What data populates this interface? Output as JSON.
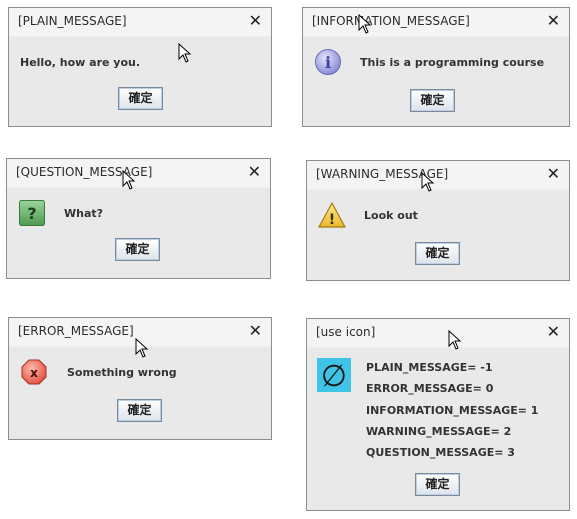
{
  "dialogs": [
    {
      "title": "[PLAIN_MESSAGE]",
      "message": "Hello, how are you.",
      "ok_label": "確定",
      "icon": "none"
    },
    {
      "title": "[INFORMATION_MESSAGE]",
      "message": "This is a programming course",
      "ok_label": "確定",
      "icon": "info-icon"
    },
    {
      "title": "[QUESTION_MESSAGE]",
      "message": "What?",
      "ok_label": "確定",
      "icon": "question-icon"
    },
    {
      "title": "[WARNING_MESSAGE]",
      "message": "Look out",
      "ok_label": "確定",
      "icon": "warning-icon"
    },
    {
      "title": "[ERROR_MESSAGE]",
      "message": "Something wrong",
      "ok_label": "確定",
      "icon": "error-icon"
    },
    {
      "title": "[use icon]",
      "messages": [
        "PLAIN_MESSAGE= -1",
        "ERROR_MESSAGE= 0",
        "INFORMATION_MESSAGE= 1",
        "WARNING_MESSAGE= 2",
        "QUESTION_MESSAGE= 3"
      ],
      "ok_label": "確定",
      "icon": "empty-set-icon"
    }
  ],
  "close_glyph": "✕",
  "icon_glyphs": {
    "info": "i",
    "question": "?",
    "warning": "!",
    "error": "x",
    "empty_set": "∅"
  },
  "colors": {
    "info": "#8a8ad6",
    "question": "#4f9a4f",
    "warning": "#e9b82c",
    "error": "#e05040",
    "custom_icon_bg": "#3fc4e8"
  }
}
